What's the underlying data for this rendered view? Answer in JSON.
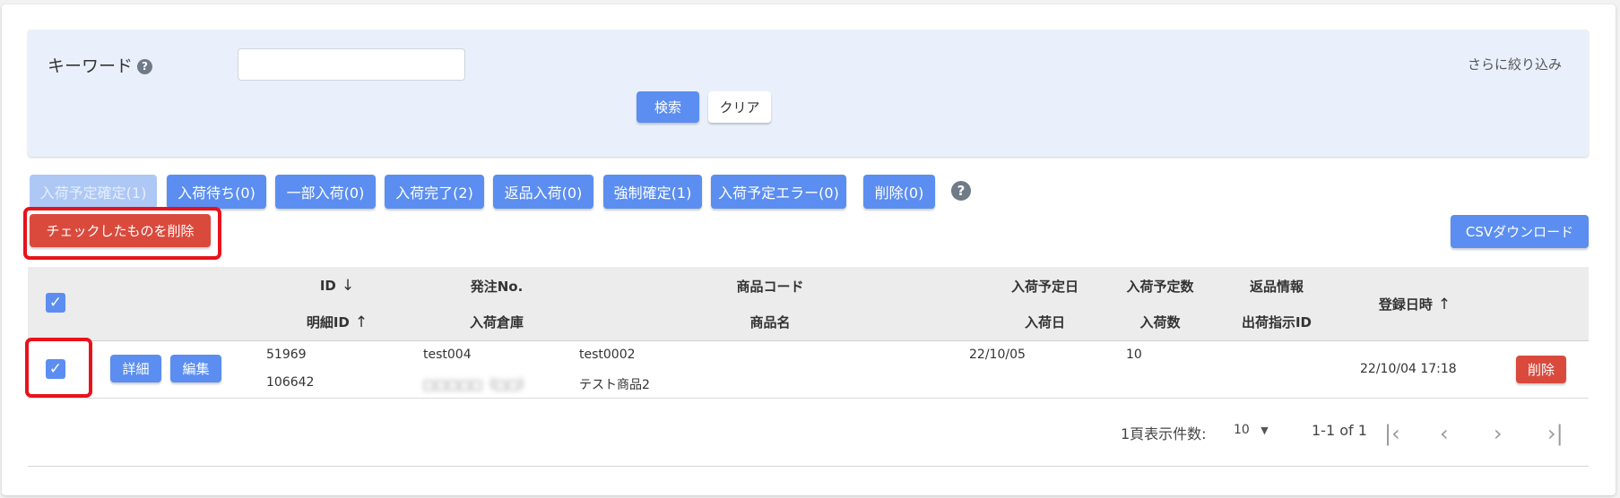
{
  "search": {
    "keyword_label": "キーワード",
    "keyword_value": "",
    "keyword_placeholder": "",
    "help_glyph": "?",
    "more_filters": "さらに絞り込み",
    "search_label": "検索",
    "clear_label": "クリア"
  },
  "status_tabs": [
    {
      "label": "入荷予定確定(1)",
      "state": "selected"
    },
    {
      "label": "入荷待ち(0)"
    },
    {
      "label": "一部入荷(0)"
    },
    {
      "label": "入荷完了(2)"
    },
    {
      "label": "返品入荷(0)"
    },
    {
      "label": "強制確定(1)"
    },
    {
      "label": "入荷予定エラー(0)"
    },
    {
      "label": "削除(0)"
    }
  ],
  "help_glyph": "?",
  "actions": {
    "delete_checked": "チェックしたものを削除",
    "csv_download": "CSVダウンロード"
  },
  "table": {
    "headers": {
      "id": "ID",
      "detail_id": "明細ID",
      "order_no": "発注No.",
      "warehouse": "入荷倉庫",
      "product_code": "商品コード",
      "product_name": "商品名",
      "planned_date": "入荷予定日",
      "arrival_date": "入荷日",
      "planned_qty": "入荷予定数",
      "arrival_qty": "入荷数",
      "return_info": "返品情報",
      "shipping_id": "出荷指示ID",
      "registered_at": "登録日時"
    },
    "sort_icons": {
      "id": "↓",
      "detail_id": "↑",
      "registered_at": "↑"
    },
    "rows": [
      {
        "checked": true,
        "detail_label": "詳細",
        "edit_label": "編集",
        "id": "51969",
        "detail_id": "106642",
        "order_no": "test004",
        "warehouse": "□□□□□（□□）",
        "product_code": "test0002",
        "product_name": "テスト商品2",
        "planned_date": "22/10/05",
        "planned_qty": "10",
        "registered_at": "22/10/04 17:18",
        "delete_label": "削除"
      }
    ]
  },
  "pagination": {
    "per_page_label": "1頁表示件数:",
    "per_page_value": "10",
    "range": "1-1 of 1"
  },
  "colors": {
    "primary": "#5b8ef0",
    "danger": "#d94a3d",
    "highlight": "#e8121b",
    "panel": "#eaf0fb"
  }
}
